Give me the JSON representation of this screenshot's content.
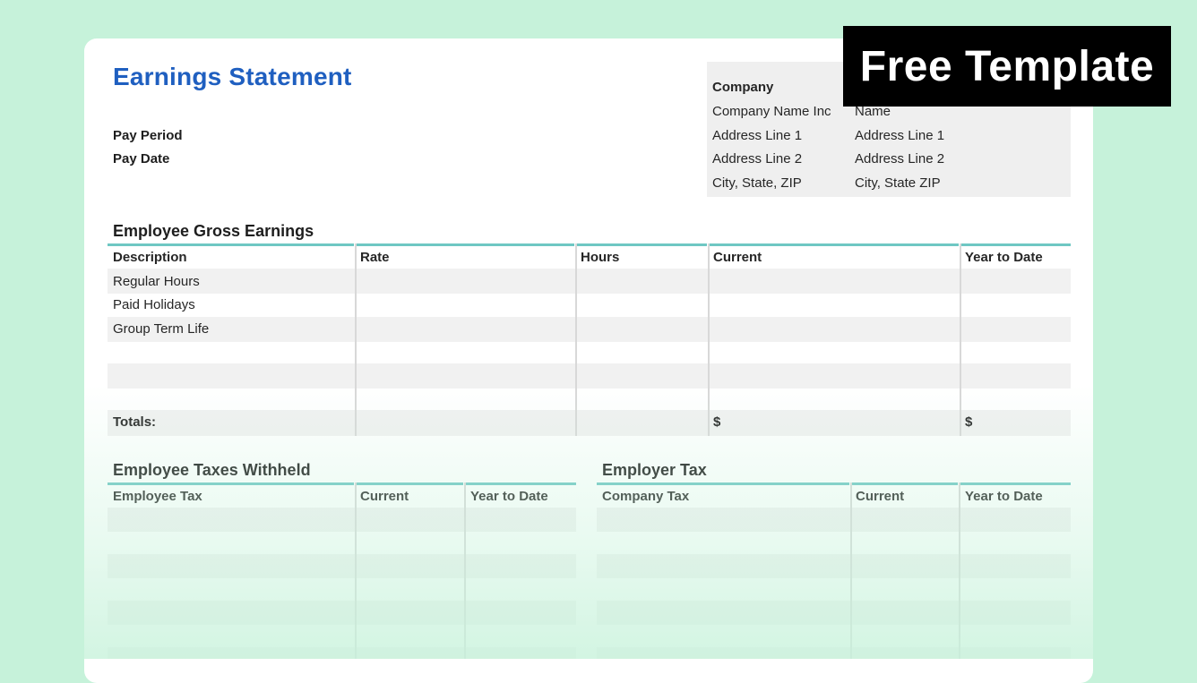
{
  "document": {
    "title": "Earnings Statement",
    "pay_period_label": "Pay Period",
    "pay_date_label": "Pay Date"
  },
  "company_info": {
    "header": "Company",
    "left_lines": [
      "Company Name Inc",
      "Address Line 1",
      "Address Line 2",
      "City, State, ZIP"
    ],
    "right_lines": [
      "Name",
      "Address Line 1",
      "Address Line 2",
      "City, State ZIP"
    ]
  },
  "gross_earnings": {
    "title": "Employee Gross Earnings",
    "columns": [
      "Description",
      "Rate",
      "Hours",
      "Current",
      "Year to Date"
    ],
    "rows": [
      "Regular Hours",
      "Paid Holidays",
      "Group Term Life"
    ],
    "totals_label": "Totals:",
    "currency_symbol": "$"
  },
  "taxes_withheld": {
    "title": "Employee Taxes Withheld",
    "columns": [
      "Employee Tax",
      "Current",
      "Year to Date"
    ]
  },
  "employer_tax": {
    "title": "Employer Tax",
    "columns": [
      "Company Tax",
      "Current",
      "Year to Date"
    ]
  },
  "badge": {
    "label": "Free Template"
  },
  "colors": {
    "background": "#c6f2da",
    "title": "#1f5fc0",
    "table_rule": "#6fc7c3",
    "shaded_row": "#f1f1f1",
    "badge": "#000000"
  }
}
